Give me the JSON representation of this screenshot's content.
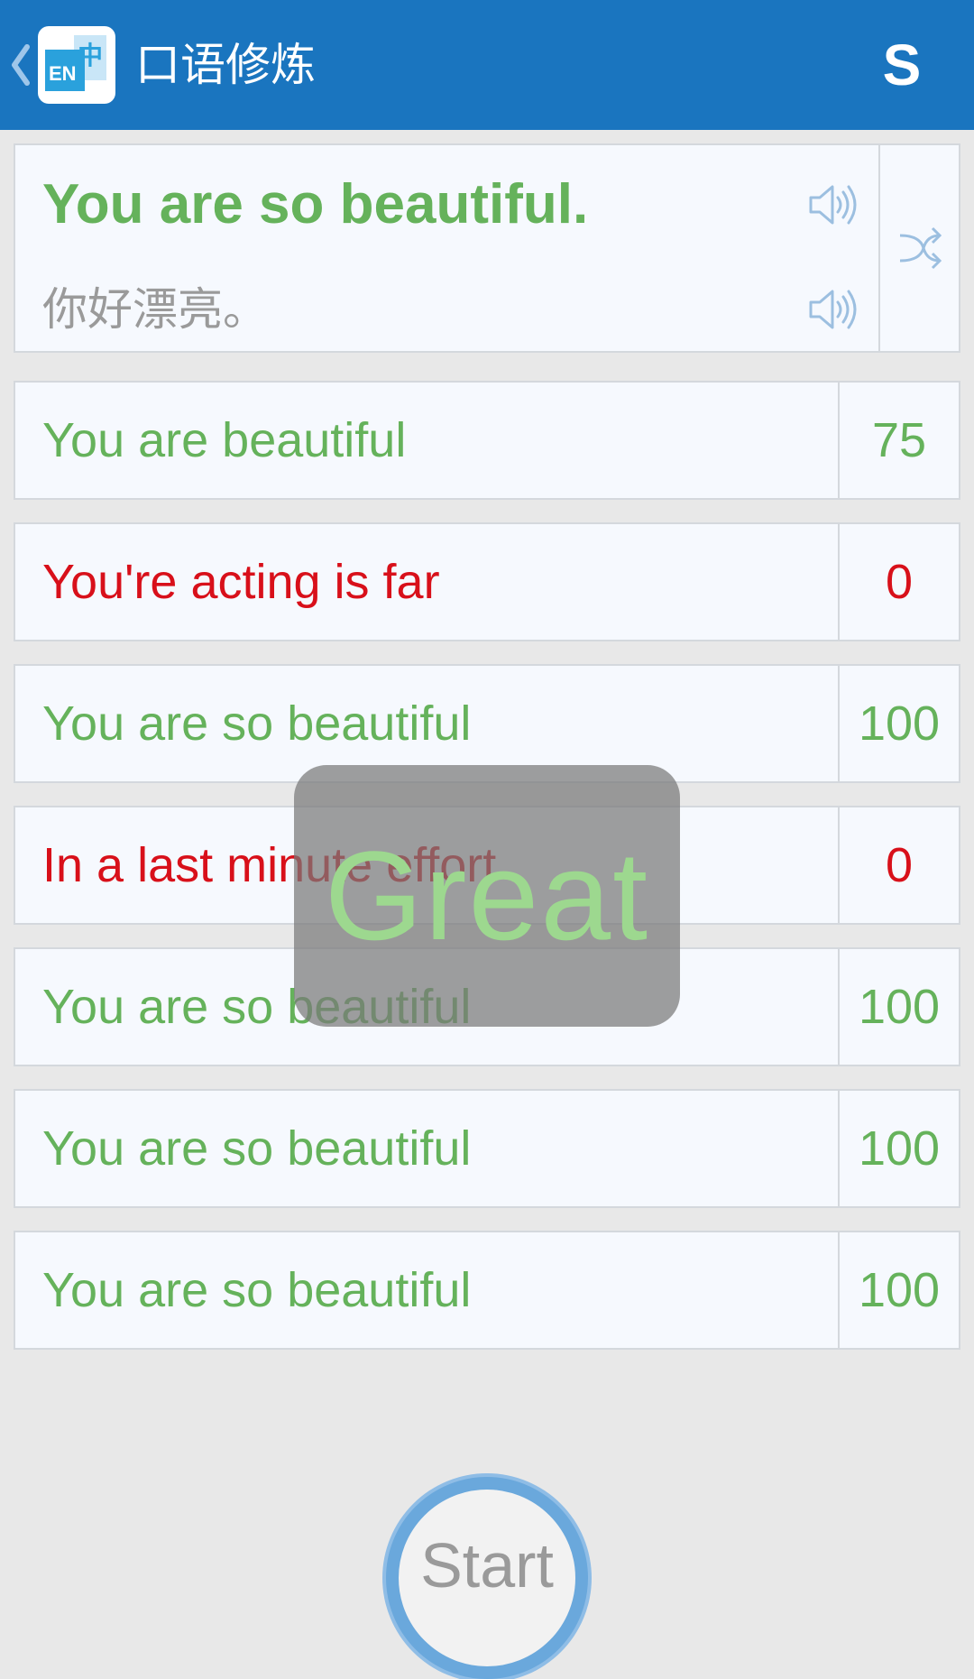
{
  "header": {
    "title": "口语修炼",
    "logo_text": "EN中",
    "action_label": "S"
  },
  "sentence": {
    "english": "You are so beautiful.",
    "chinese": "你好漂亮。"
  },
  "results": [
    {
      "text": "You are beautiful",
      "score": "75",
      "status": "good"
    },
    {
      "text": "You're acting is far",
      "score": "0",
      "status": "bad"
    },
    {
      "text": "You are so beautiful",
      "score": "100",
      "status": "good"
    },
    {
      "text": "In a last minute effort",
      "score": "0",
      "status": "bad"
    },
    {
      "text": "You are so beautiful",
      "score": "100",
      "status": "good"
    },
    {
      "text": "You are so beautiful",
      "score": "100",
      "status": "good"
    },
    {
      "text": "You are so beautiful",
      "score": "100",
      "status": "good"
    }
  ],
  "toast": {
    "text": "Great"
  },
  "start_button": {
    "label": "Start"
  },
  "colors": {
    "header_bg": "#1a75bf",
    "good": "#65b25b",
    "bad": "#d8101a",
    "start_ring": "#6aa8dc"
  }
}
